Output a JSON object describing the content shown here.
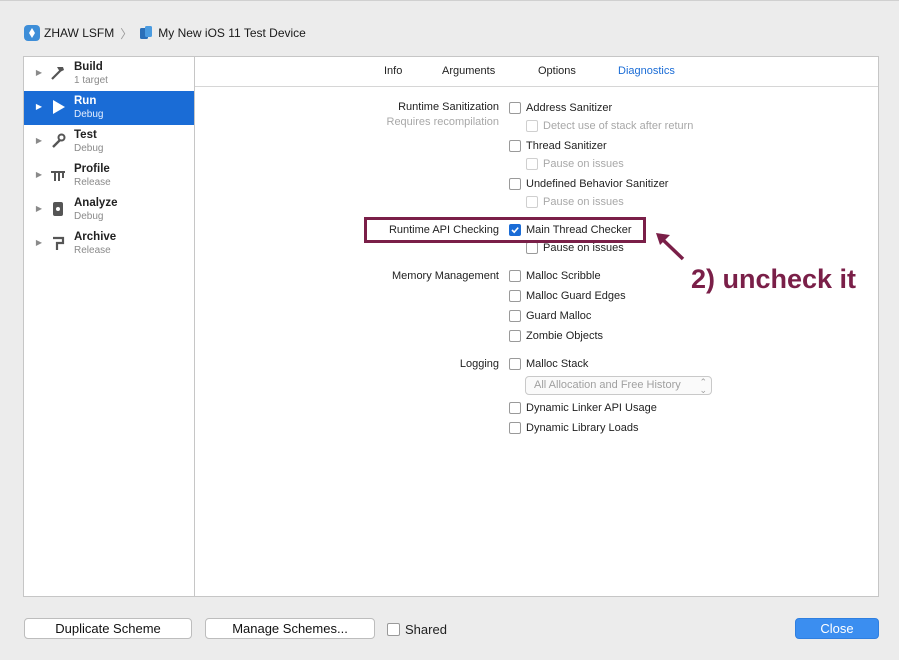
{
  "breadcrumb": {
    "project": "ZHAW LSFM",
    "device": "My New iOS 11 Test Device"
  },
  "sidebar": {
    "items": [
      {
        "name": "Build",
        "sub": "1 target",
        "icon": "hammer-icon"
      },
      {
        "name": "Run",
        "sub": "Debug",
        "icon": "play-icon"
      },
      {
        "name": "Test",
        "sub": "Debug",
        "icon": "wrench-icon"
      },
      {
        "name": "Profile",
        "sub": "Release",
        "icon": "tuning-fork-icon"
      },
      {
        "name": "Analyze",
        "sub": "Debug",
        "icon": "analyze-icon"
      },
      {
        "name": "Archive",
        "sub": "Release",
        "icon": "archive-icon"
      }
    ],
    "selected_index": 1
  },
  "tabs": [
    "Info",
    "Arguments",
    "Options",
    "Diagnostics"
  ],
  "active_tab": "Diagnostics",
  "sections": {
    "runtime_sanitization": {
      "label": "Runtime Sanitization",
      "sublabel": "Requires recompilation",
      "address_sanitizer": "Address Sanitizer",
      "detect_stack": "Detect use of stack after return",
      "thread_sanitizer": "Thread Sanitizer",
      "pause_1": "Pause on issues",
      "undefined_behavior": "Undefined Behavior Sanitizer",
      "pause_2": "Pause on issues"
    },
    "runtime_api": {
      "label": "Runtime API Checking",
      "main_thread_checker": "Main Thread Checker",
      "main_thread_checked": true,
      "pause": "Pause on issues"
    },
    "memory": {
      "label": "Memory Management",
      "malloc_scribble": "Malloc Scribble",
      "malloc_guard_edges": "Malloc Guard Edges",
      "guard_malloc": "Guard Malloc",
      "zombie_objects": "Zombie Objects"
    },
    "logging": {
      "label": "Logging",
      "malloc_stack": "Malloc Stack",
      "malloc_stack_option": "All Allocation and Free History",
      "dynamic_linker_api": "Dynamic Linker API Usage",
      "dynamic_library_loads": "Dynamic Library Loads"
    }
  },
  "annotation": "2) uncheck it",
  "footer": {
    "duplicate": "Duplicate Scheme",
    "manage": "Manage Schemes...",
    "shared": "Shared",
    "close": "Close"
  },
  "colors": {
    "accent": "#1a6cd6",
    "annotation": "#7a1f48"
  }
}
